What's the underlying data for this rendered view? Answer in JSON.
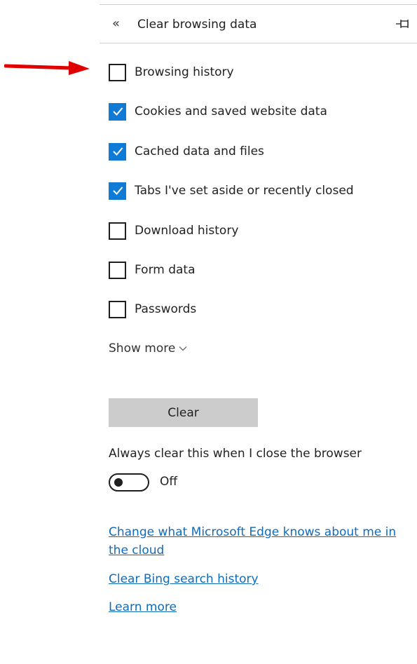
{
  "panel": {
    "title": "Clear browsing data",
    "back_icon": "«"
  },
  "items": [
    {
      "label": "Browsing history",
      "checked": false
    },
    {
      "label": "Cookies and saved website data",
      "checked": true
    },
    {
      "label": "Cached data and files",
      "checked": true
    },
    {
      "label": "Tabs I've set aside or recently closed",
      "checked": true
    },
    {
      "label": "Download history",
      "checked": false
    },
    {
      "label": "Form data",
      "checked": false
    },
    {
      "label": "Passwords",
      "checked": false
    }
  ],
  "show_more": "Show more",
  "clear_button": "Clear",
  "always_clear": {
    "label": "Always clear this when I close the browser",
    "toggle_state": "Off",
    "enabled": false
  },
  "links": {
    "cloud": "Change what Microsoft Edge knows about me in the cloud",
    "bing": "Clear Bing search history",
    "learn": "Learn more"
  },
  "colors": {
    "accent": "#0f7bd7",
    "link": "#0f6cbd",
    "arrow": "#e00000",
    "button": "#cccccc"
  }
}
